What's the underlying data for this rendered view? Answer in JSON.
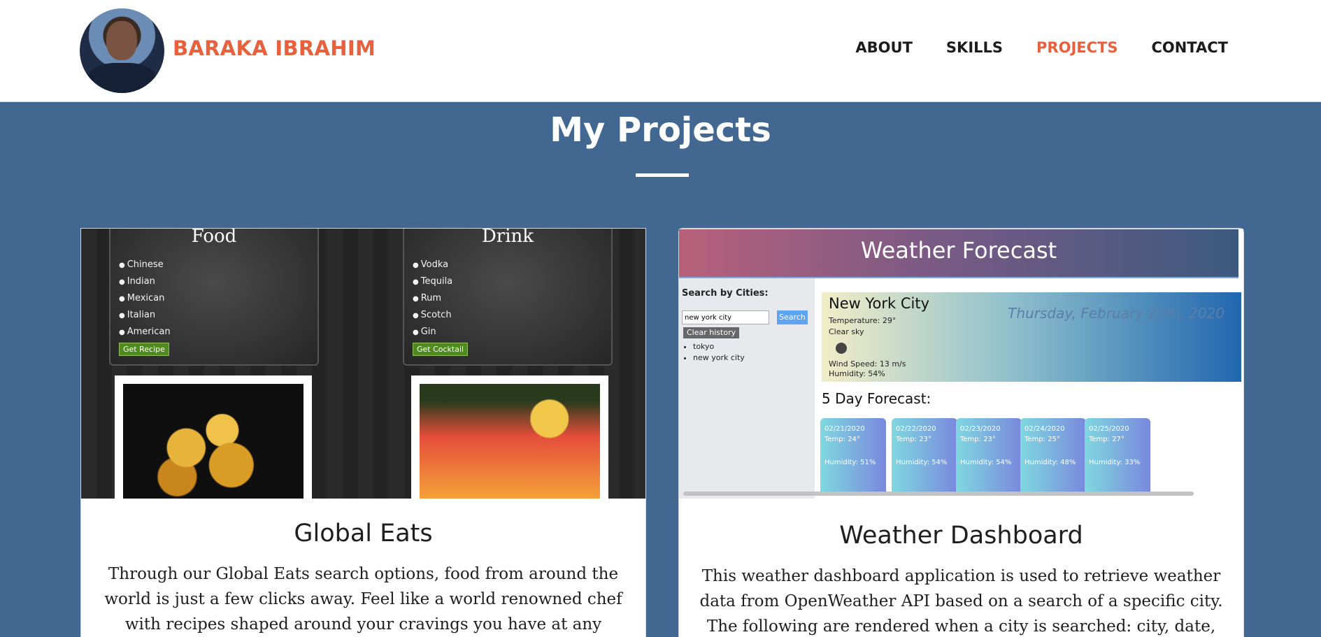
{
  "header": {
    "brand": "BARAKA IBRAHIM",
    "nav": [
      {
        "label": "ABOUT",
        "active": false
      },
      {
        "label": "SKILLS",
        "active": false
      },
      {
        "label": "PROJECTS",
        "active": true
      },
      {
        "label": "CONTACT",
        "active": false
      }
    ]
  },
  "section": {
    "title": "My Projects"
  },
  "colors": {
    "accent": "#e8613f",
    "background": "#426891"
  },
  "projects": [
    {
      "title": "Global Eats",
      "description": "Through our Global Eats search options, food from around the world is just a few clicks away. Feel like a world renowned chef with recipes shaped around your cravings you have at any",
      "screenshot": {
        "food_heading": "Food",
        "food_items": [
          "Chinese",
          "Indian",
          "Mexican",
          "Italian",
          "American"
        ],
        "food_button": "Get Recipe",
        "drink_heading": "Drink",
        "drink_items": [
          "Vodka",
          "Tequila",
          "Rum",
          "Scotch",
          "Gin"
        ],
        "drink_button": "Get Cocktail"
      }
    },
    {
      "title": "Weather Dashboard",
      "description": "This weather dashboard application is used to retrieve weather data from OpenWeather API based on a search of a specific city. The following are rendered when a city is searched: city, date,",
      "screenshot": {
        "app_title": "Weather Forecast",
        "search_label": "Search by Cities:",
        "search_value": "new york city",
        "search_button": "Search",
        "clear_button": "Clear history",
        "history": [
          "tokyo",
          "new york city"
        ],
        "city": "New York City",
        "date": "Thursday, February 20th, 2020",
        "temperature": "Temperature: 29°",
        "condition": "Clear sky",
        "wind": "Wind Speed: 13 m/s",
        "humidity": "Humidity: 54%",
        "forecast_title": "5 Day Forecast:",
        "forecast": [
          {
            "date": "02/21/2020",
            "temp": "Temp: 24°",
            "humidity": "Humidity: 51%"
          },
          {
            "date": "02/22/2020",
            "temp": "Temp: 23°",
            "humidity": "Humidity: 54%"
          },
          {
            "date": "02/23/2020",
            "temp": "Temp: 23°",
            "humidity": "Humidity: 54%"
          },
          {
            "date": "02/24/2020",
            "temp": "Temp: 25°",
            "humidity": "Humidity: 48%"
          },
          {
            "date": "02/25/2020",
            "temp": "Temp: 27°",
            "humidity": "Humidity: 33%"
          }
        ]
      }
    }
  ]
}
